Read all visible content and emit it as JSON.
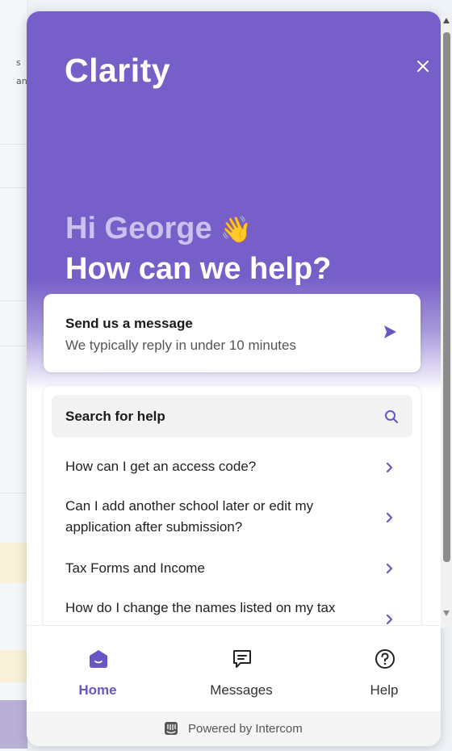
{
  "background_page": {
    "fragments": [
      "s",
      "an"
    ]
  },
  "header": {
    "brand": "Clarity",
    "close_icon": "close-icon",
    "greeting": "Hi George",
    "greeting_emoji": "👋",
    "headline": "How can we help?"
  },
  "send_message": {
    "title": "Send us a message",
    "subtitle": "We typically reply in under 10 minutes",
    "icon": "send-icon"
  },
  "help": {
    "search_label": "Search for help",
    "search_icon": "search-icon",
    "articles": [
      {
        "label": "How can I get an access code?"
      },
      {
        "label": "Can I add another school later or edit my application after submission?"
      },
      {
        "label": "Tax Forms and Income"
      },
      {
        "label": "How do I change the names listed on my tax"
      }
    ]
  },
  "nav": {
    "items": [
      {
        "label": "Home",
        "icon": "home-icon",
        "active": true
      },
      {
        "label": "Messages",
        "icon": "messages-icon",
        "active": false
      },
      {
        "label": "Help",
        "icon": "help-icon",
        "active": false
      }
    ]
  },
  "footer": {
    "text": "Powered by Intercom",
    "icon": "intercom-logo-icon"
  },
  "colors": {
    "brand": "#765fc8",
    "accent": "#6a55c4",
    "greeting": "#cbc1ee"
  }
}
